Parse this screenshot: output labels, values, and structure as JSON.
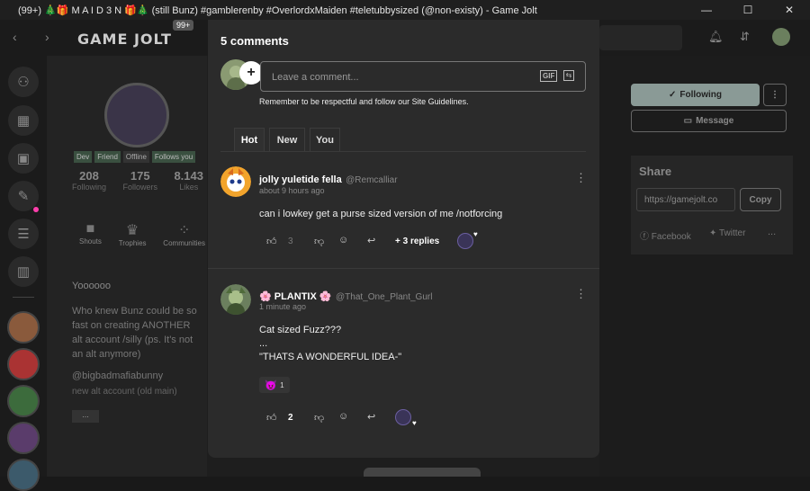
{
  "window": {
    "title": "(99+) 🎄🎁 M A I D 3 N 🎁🎄 (still Bunz) #gamblerenby #OverlordxMaiden #teletubbysized (@non-existy) - Game Jolt",
    "minimize": "—",
    "maximize": "☐",
    "close": "✕"
  },
  "nav": {
    "logo": "GAME JOLT",
    "badge": "99+"
  },
  "profile": {
    "tags": [
      "Dev",
      "Friend",
      "Offline",
      "Follows you"
    ],
    "stats": [
      {
        "value": "208",
        "label": "Following"
      },
      {
        "value": "175",
        "label": "Followers"
      },
      {
        "value": "8.143",
        "label": "Likes"
      }
    ],
    "links": [
      "Shouts",
      "Trophies",
      "Communities"
    ],
    "bio_short": "Yoooooo",
    "bio": [
      "Who knew Bunz could be so",
      "fast on creating ANOTHER",
      "alt account /silly (ps. It's not",
      "an alt anymore)"
    ],
    "mention": "@bigbadmafiabunny",
    "mention_sub": "new alt account (old main)",
    "more": "..."
  },
  "right": {
    "following": "Following",
    "message": "Message",
    "share_title": "Share",
    "share_url": "https://gamejolt.co",
    "copy": "Copy",
    "facebook": "Facebook",
    "twitter": "Twitter",
    "more": "..."
  },
  "modal": {
    "title": "5 comments",
    "input_placeholder": "Leave a comment...",
    "gif": "GIF",
    "guidelines": "Remember to be respectful and follow our Site Guidelines.",
    "tabs": [
      "Hot",
      "New",
      "You"
    ],
    "comments": [
      {
        "name": "jolly yuletide fella",
        "handle": "@Remcalliar",
        "time": "about 9 hours ago",
        "lines": [
          "can i lowkey get a purse sized version of me /notforcing"
        ],
        "likes": "3",
        "replies": "+ 3 replies"
      },
      {
        "name": "🌸 PLANTIX 🌸",
        "handle": "@That_One_Plant_Gurl",
        "time": "1 minute ago",
        "lines": [
          "Cat sized Fuzz???",
          "...",
          "\"THATS A WONDERFUL IDEA-\""
        ],
        "reaction_count": "1",
        "likes": "2"
      }
    ]
  }
}
